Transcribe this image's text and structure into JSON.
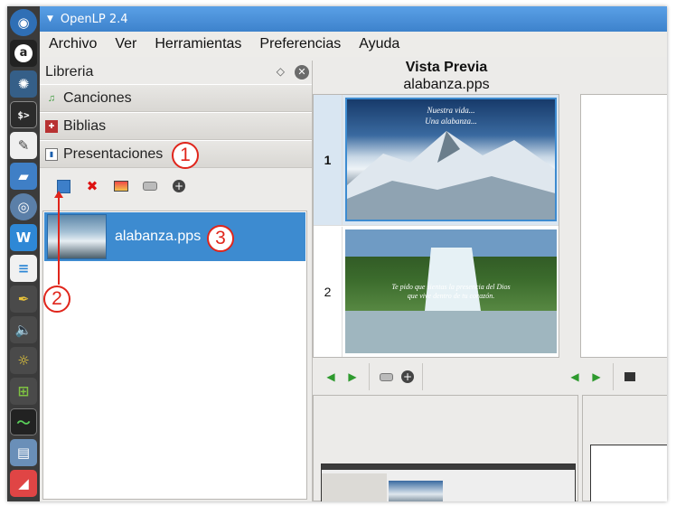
{
  "window": {
    "title": "OpenLP 2.4"
  },
  "menu": [
    "Archivo",
    "Ver",
    "Herramientas",
    "Preferencias",
    "Ayuda"
  ],
  "library": {
    "title": "Libreria",
    "sections": [
      "Canciones",
      "Biblias",
      "Presentaciones"
    ],
    "items": [
      {
        "name": "alabanza.pps"
      }
    ]
  },
  "preview": {
    "title": "Vista Previa",
    "file": "alabanza.pps",
    "slides": [
      {
        "number": "1",
        "lines": [
          "Nuestra vida...",
          "Una alabanza..."
        ]
      },
      {
        "number": "2",
        "lines": [
          "Te pido que sientas la presencia del Dios",
          "que vive dentro de tu corazón."
        ]
      }
    ]
  },
  "callouts": [
    "1",
    "2",
    "3"
  ],
  "colors": {
    "accent": "#3d8bd0",
    "titlebar": "#4a90d9",
    "callout": "#e0251b"
  },
  "icons": {
    "launcher": [
      "ubuntu-dash-icon",
      "amazon-icon",
      "settings-icon",
      "terminal-icon",
      "text-editor-icon",
      "files-icon",
      "disc-icon",
      "writer-icon",
      "document-icon",
      "pen-icon",
      "volume-icon",
      "brightness-icon",
      "windows-icon",
      "system-monitor-icon",
      "drive-icon",
      "openlp-icon"
    ],
    "toolbar": [
      "load-icon",
      "delete-icon",
      "preview-icon",
      "go-live-icon",
      "add-to-service-icon"
    ]
  }
}
